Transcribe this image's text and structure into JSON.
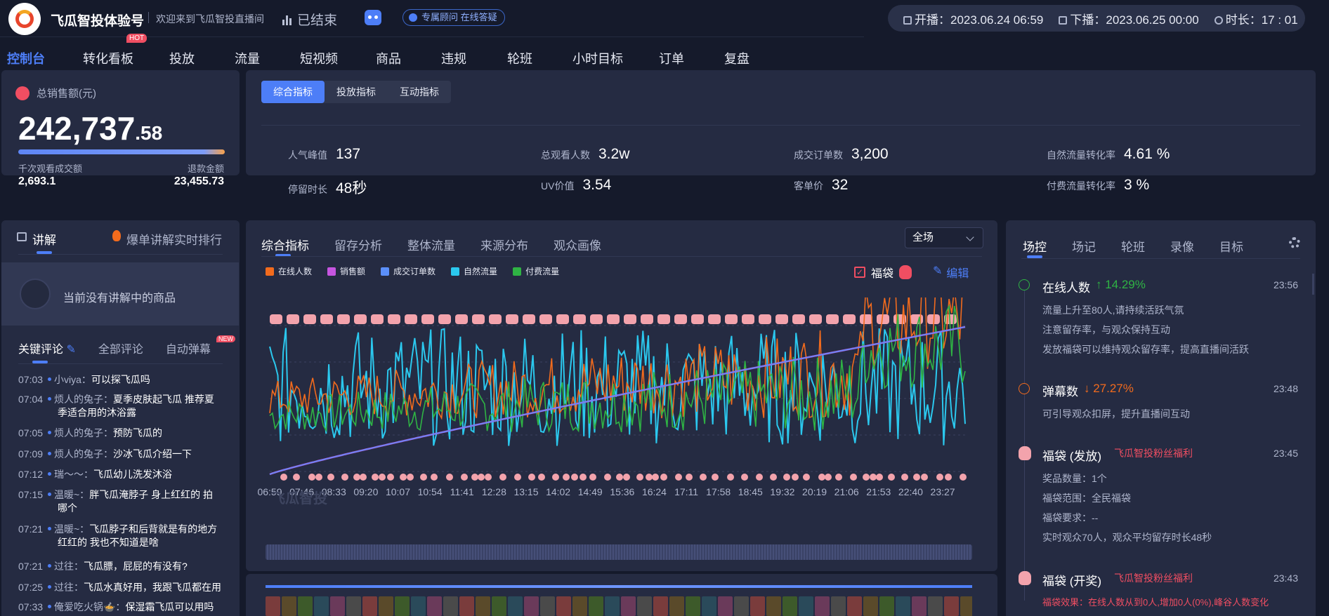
{
  "header": {
    "brand": "飞瓜智投体验号",
    "welcome": "欢迎来到飞瓜智投直播间",
    "status": "已结束",
    "advisor": "专属顾问 在线答疑",
    "start": "开播：2023.06.24 06:59",
    "end": "下播：2023.06.25 00:00",
    "duration": "时长：17 : 01"
  },
  "nav": {
    "tabs": [
      "控制台",
      "转化看板",
      "投放",
      "流量",
      "短视频",
      "商品",
      "违规",
      "轮班",
      "小时目标",
      "订单",
      "复盘"
    ],
    "hot_badge": "HOT"
  },
  "sales": {
    "title": "总销售额(元)",
    "value_int": "242,737",
    "value_dec": ".58",
    "metric1_label": "千次观看成交额",
    "metric1_value": "2,693.1",
    "metric2_label": "退款金额",
    "metric2_value": "23,455.73"
  },
  "indicators": {
    "tabs": [
      "综合指标",
      "投放指标",
      "互动指标"
    ],
    "items": [
      {
        "label": "人气峰值",
        "value": "137"
      },
      {
        "label": "总观看人数",
        "value": "3.2w"
      },
      {
        "label": "成交订单数",
        "value": "3,200"
      },
      {
        "label": "自然流量转化率",
        "value": "4.61 %"
      },
      {
        "label": "停留时长",
        "value": "48秒"
      },
      {
        "label": "UV价值",
        "value": "3.54"
      },
      {
        "label": "客单价",
        "value": "32"
      },
      {
        "label": "付费流量转化率",
        "value": "3 %"
      }
    ]
  },
  "explain": {
    "tab1": "讲解",
    "tab2": "爆单讲解实时排行",
    "empty": "当前没有讲解中的商品"
  },
  "comments": {
    "tabs": [
      "关键评论",
      "全部评论",
      "自动弹幕"
    ],
    "new_badge": "NEW",
    "items": [
      {
        "time": "07:03",
        "user": "小viya：",
        "text": "可以探飞瓜吗"
      },
      {
        "time": "07:04",
        "user": "烦人的兔子：",
        "text": "夏季皮肤起飞瓜 推荐夏",
        "cont": "季适合用的沐浴露"
      },
      {
        "time": "07:05",
        "user": "烦人的兔子：",
        "text": "预防飞瓜的"
      },
      {
        "time": "07:09",
        "user": "烦人的兔子：",
        "text": "沙冰飞瓜介绍一下"
      },
      {
        "time": "07:12",
        "user": "瑞～～：",
        "text": "飞瓜幼儿洗发沐浴"
      },
      {
        "time": "07:15",
        "user": "温暖~：",
        "text": "胖飞瓜淹脖子 身上红红的 拍",
        "cont": "哪个"
      },
      {
        "time": "07:21",
        "user": "温暖~：",
        "text": "飞瓜脖子和后背就是有的地方",
        "cont": "红红的 我也不知道是啥"
      },
      {
        "time": "07:21",
        "user": "过往：",
        "text": "飞瓜膘，屁屁的有没有?"
      },
      {
        "time": "07:25",
        "user": "过往：",
        "text": "飞瓜水真好用，我跟飞瓜都在用"
      },
      {
        "time": "07:33",
        "user": "俺爱吃火锅🍲：",
        "text": "保湿霜飞瓜可以用吗"
      }
    ]
  },
  "chart_panel": {
    "tabs": [
      "综合指标",
      "留存分析",
      "整体流量",
      "来源分布",
      "观众画像"
    ],
    "select": "全场",
    "fudai_label": "福袋",
    "edit_label": "编辑",
    "watermark": "飞瓜智投"
  },
  "chart_data": {
    "type": "line",
    "legend": [
      {
        "name": "在线人数",
        "color": "#f26b1d"
      },
      {
        "name": "销售额",
        "color": "#c655e0"
      },
      {
        "name": "成交订单数",
        "color": "#5b8ff9"
      },
      {
        "name": "自然流量",
        "color": "#2bc8ee"
      },
      {
        "name": "付费流量",
        "color": "#2fb344"
      }
    ],
    "x_ticks": [
      "06:59",
      "07:46",
      "08:33",
      "09:20",
      "10:07",
      "10:54",
      "11:41",
      "12:28",
      "13:15",
      "14:02",
      "14:49",
      "15:36",
      "16:24",
      "17:11",
      "17:58",
      "18:45",
      "19:32",
      "20:19",
      "21:06",
      "21:53",
      "22:40",
      "23:27"
    ]
  },
  "right_panel": {
    "tabs": [
      "场控",
      "场记",
      "轮班",
      "录像",
      "目标"
    ],
    "events": [
      {
        "title": "在线人数",
        "delta": "↑ 14.29%",
        "delta_color": "#2fb344",
        "time": "23:56",
        "lines": [
          "流量上升至80人,请持续活跃气氛",
          "注意留存率，与观众保持互动",
          "发放福袋可以维持观众留存率，提高直播间活跃"
        ]
      },
      {
        "title": "弹幕数",
        "delta": "↓ 27.27%",
        "delta_color": "#f26b1d",
        "time": "23:48",
        "lines": [
          "可引导观众扣屏，提升直播间互动"
        ]
      },
      {
        "title": "福袋 (发放)",
        "delta": "飞瓜智投粉丝福利",
        "delta_color": "#f04e62",
        "time": "23:45",
        "lines": [
          "奖品数量：1个",
          "福袋范围：全民福袋",
          "福袋要求：--",
          "实时观众70人，观众平均留存时长48秒"
        ]
      },
      {
        "title": "福袋 (开奖)",
        "delta": "飞瓜智投粉丝福利",
        "delta_color": "#f04e62",
        "time": "23:43",
        "lines": [
          "福袋效果：在线人数从到0人,增加0人(0%),峰谷人数变化"
        ]
      }
    ]
  }
}
